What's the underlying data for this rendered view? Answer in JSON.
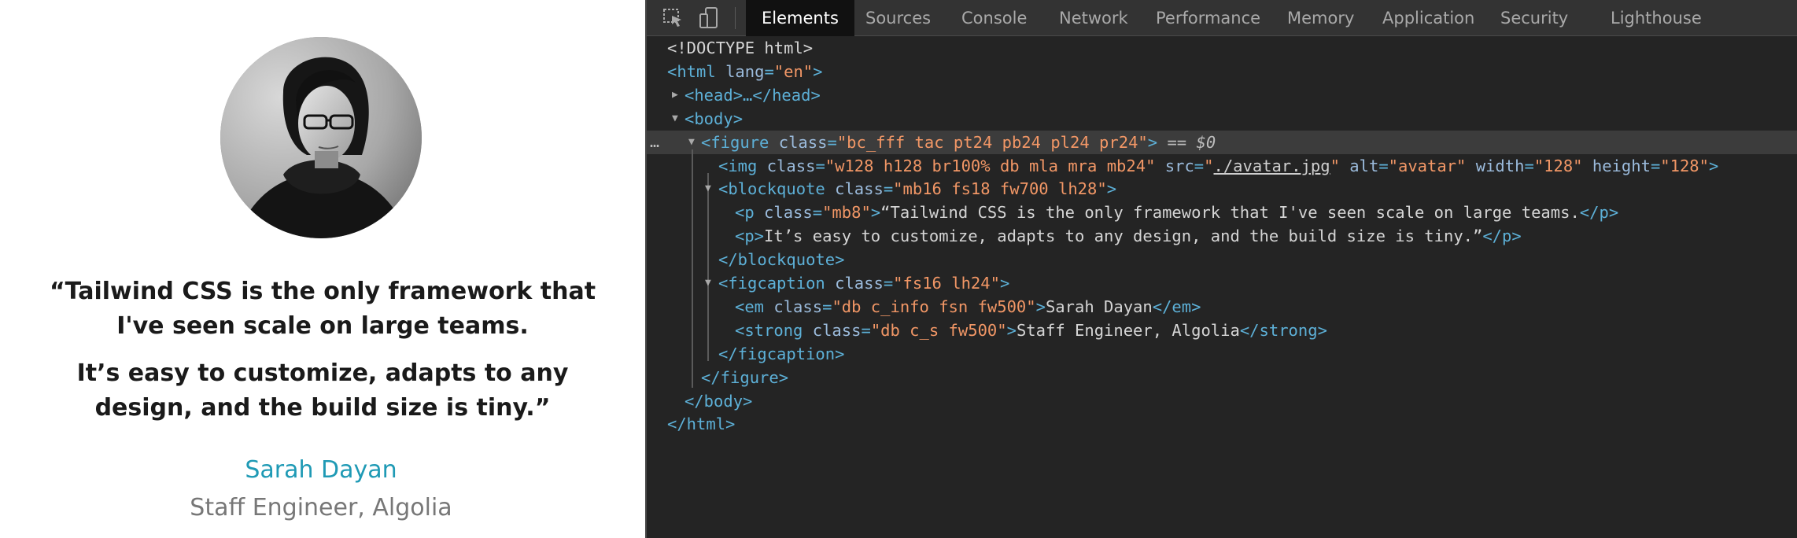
{
  "preview": {
    "avatar_alt": "avatar",
    "quote_line_1": "“Tailwind CSS is the only framework that I've seen scale on large teams.",
    "quote_line_2": "It’s easy to customize, adapts to any design, and the build size is tiny.”",
    "author_name": "Sarah Dayan",
    "author_role": "Staff Engineer, Algolia"
  },
  "devtools": {
    "tabs": [
      "Elements",
      "Sources",
      "Console",
      "Network",
      "Performance",
      "Memory",
      "Application",
      "Security",
      "Lighthouse"
    ],
    "active_tab": "Elements",
    "selected_marker": "== $0",
    "ellipsis": "…",
    "dom": {
      "doctype": "<!DOCTYPE html>",
      "html_open": "<html",
      "lang_attr": "lang",
      "lang_val": "\"en\"",
      "close_gt": ">",
      "head_collapsed": "<head>…</head>",
      "body_open": "<body>",
      "figure_open": "<figure",
      "class_attr": "class",
      "figure_class": "\"bc_fff tac pt24 pb24 pl24 pr24\"",
      "img_open": "<img",
      "img_class": "\"w128 h128 br100% db mla mra mb24\"",
      "src_attr": "src",
      "src_val": "./avatar.jpg",
      "alt_attr": "alt",
      "alt_val": "\"avatar\"",
      "width_attr": "width",
      "width_val": "\"128\"",
      "height_attr": "height",
      "height_val": "\"128\"",
      "blockquote_open": "<blockquote",
      "blockquote_class": "\"mb16 fs18 fw700 lh28\"",
      "p_open": "<p",
      "p_class": "\"mb8\"",
      "p1_text": "“Tailwind CSS is the only framework that I've seen scale on large teams.",
      "p_close": "</p>",
      "p2_open": "<p>",
      "p2_text": "It’s easy to customize, adapts to any design, and the build size is tiny.”",
      "blockquote_close": "</blockquote>",
      "figcaption_open": "<figcaption",
      "figcaption_class": "\"fs16 lh24\"",
      "em_open": "<em",
      "em_class": "\"db c_info fsn fw500\"",
      "em_text": "Sarah Dayan",
      "em_close": "</em>",
      "strong_open": "<strong",
      "strong_class": "\"db c_s fw500\"",
      "strong_text": "Staff Engineer, Algolia",
      "strong_close": "</strong>",
      "figcaption_close": "</figcaption>",
      "figure_close": "</figure>",
      "body_close": "</body>",
      "html_close": "</html>"
    }
  }
}
